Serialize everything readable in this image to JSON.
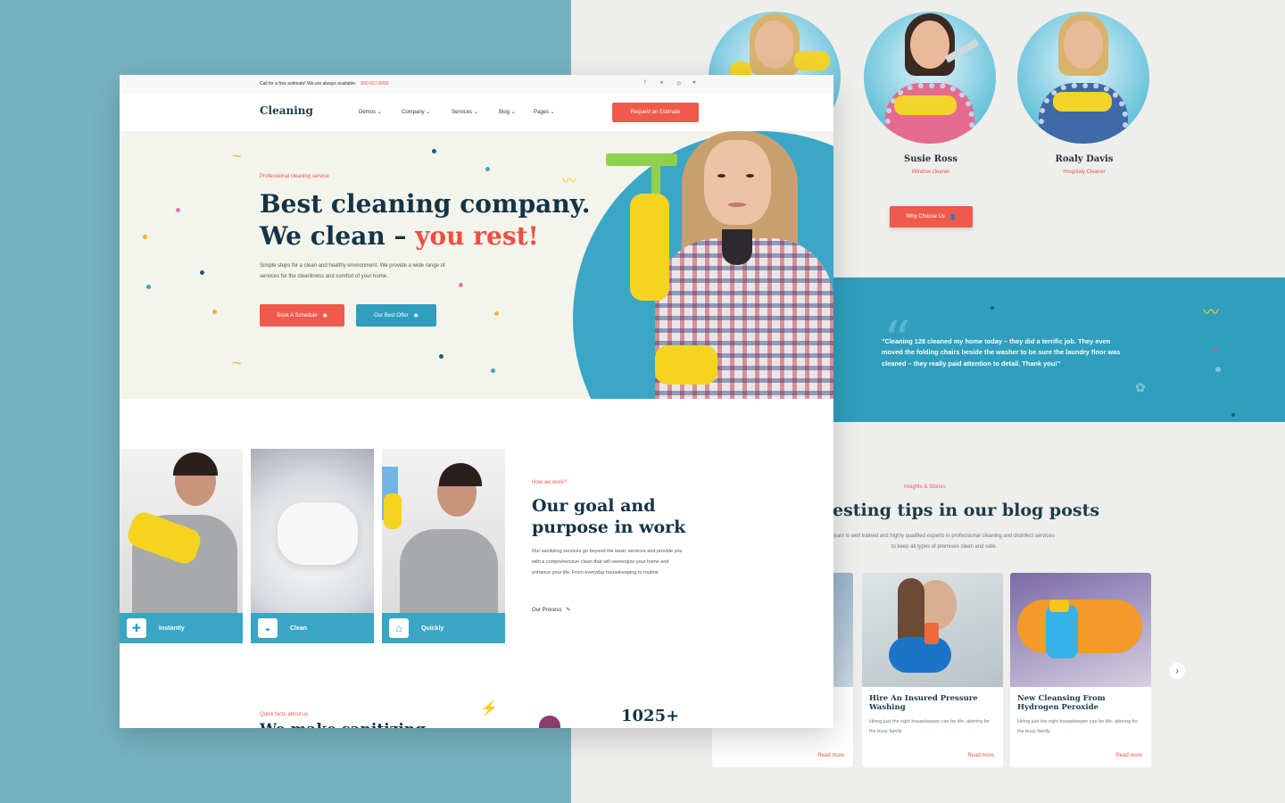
{
  "team": [
    {
      "name": "",
      "role": ""
    },
    {
      "name": "Susie Ross",
      "role": "Window cleaner"
    },
    {
      "name": "Roaly Davis",
      "role": "Hospitaly Cleaner"
    }
  ],
  "why_button": "Why Choose Us",
  "testimonial": "\"Cleaning 128 cleaned my home today – they did a terrific job. They even moved the folding chairs beside the washer to be sure the laundry floor was cleaned – they really paid attention to detail. Thank you!\"",
  "blog": {
    "eyebrow": "Insights & Stories",
    "title": "esting tips in our blog posts",
    "subtitle": "eam is well trained and highly qualified experts in professional cleaning and disinfect services to keep all types of premises clean and safe.",
    "posts": [
      {
        "title": "",
        "excerpt": "ife- altering for the busy family.",
        "more": "Read more"
      },
      {
        "title": "Hire An Insured Pressure Washing",
        "excerpt": "Hiring just the right housekeeper can be life- altering for the busy family.",
        "more": "Read more"
      },
      {
        "title": "New Cleansing From Hydrogen Peroxide",
        "excerpt": "Hiring just the right housekeeper can be life- altering for the busy family.",
        "more": "Read more"
      }
    ]
  },
  "topbar": {
    "message": "Call for a free estimate! We are always available:",
    "phone": "800-567-8990"
  },
  "nav": {
    "logo": "Cleaning",
    "items": [
      "Demos",
      "Company",
      "Services",
      "Blog",
      "Pages"
    ],
    "cta": "Request an Estimate"
  },
  "hero": {
    "eyebrow": "Professional cleaning service",
    "line1": "Best cleaning company.",
    "line2_a": "We clean – ",
    "line2_b": "you rest!",
    "desc": "Simple steps for a clean and healthy environment. We provide a wide range of services for the cleanliness and comfort of your home.",
    "btn_schedule": "Book A Schedule",
    "btn_offer": "Our Best Offer"
  },
  "features": [
    {
      "label": "Instantly",
      "icon": "spray-icon"
    },
    {
      "label": "Clean",
      "icon": "soap-icon"
    },
    {
      "label": "Quickly",
      "icon": "iron-icon"
    }
  ],
  "how": {
    "eyebrow": "How we work?",
    "title": "Our goal and purpose in work",
    "text": "Our sanitizing services go beyond the basic services and provide you with a comprehensive clean that will reenergize your home and enhance your life. From everyday housekeeping to routine",
    "link": "Our Process"
  },
  "facts": {
    "eyebrow": "Quick facts about us",
    "title": "We make sanitizing",
    "count": "1025+"
  },
  "colors": {
    "accent": "#ef5a4d",
    "brand": "#2f9fbd",
    "dark": "#143446"
  }
}
